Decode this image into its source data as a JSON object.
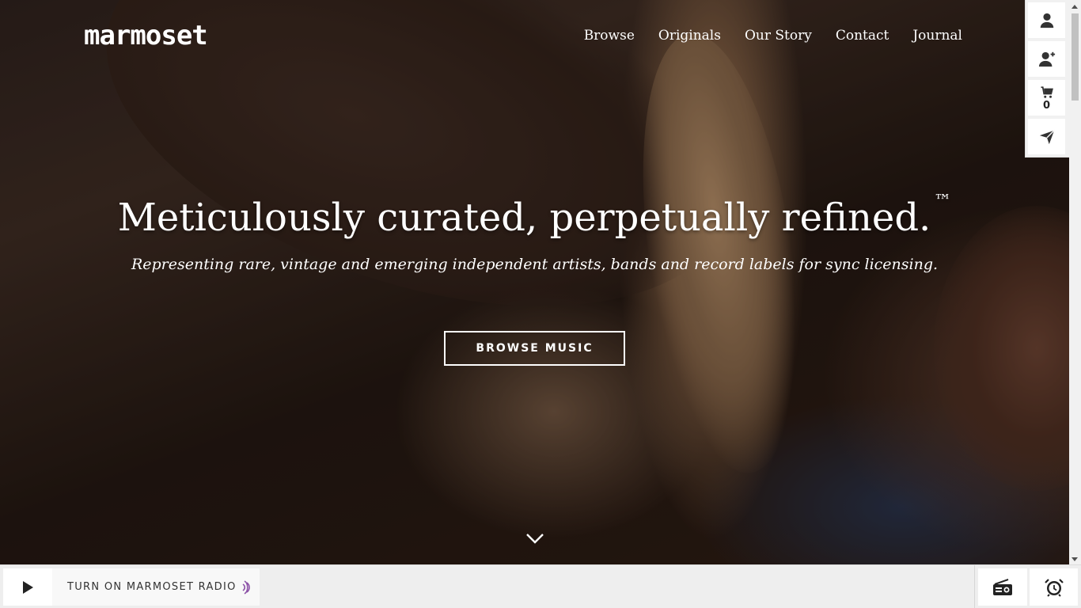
{
  "header": {
    "logo": "marmoset",
    "nav": [
      "Browse",
      "Originals",
      "Our Story",
      "Contact",
      "Journal"
    ]
  },
  "side_tools": {
    "icons": [
      "user-icon",
      "add-user-icon",
      "cart-icon",
      "send-icon"
    ],
    "cart_count": "0"
  },
  "hero": {
    "headline": "Meticulously curated, perpetually refined.",
    "trademark": "™",
    "subheadline": "Representing rare, vintage and emerging independent artists, bands and record labels for sync licensing.",
    "cta_label": "BROWSE MUSIC"
  },
  "player": {
    "radio_label": "TURN ON MARMOSET RADIO",
    "accent_color": "#8a4fa6",
    "icons": [
      "play-icon",
      "radio-icon",
      "alarm-clock-icon"
    ]
  }
}
